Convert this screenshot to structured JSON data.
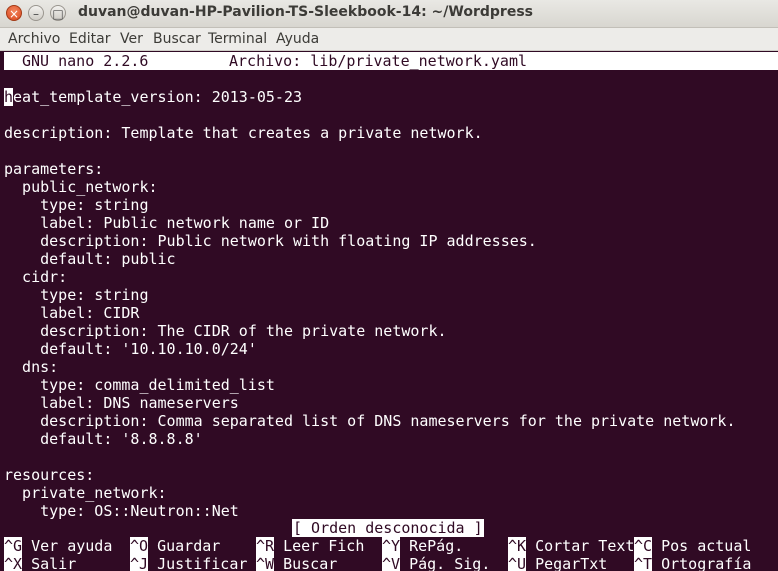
{
  "window": {
    "title": "duvan@duvan-HP-Pavilion-TS-Sleekbook-14: ~/Wordpress",
    "buttons": {
      "close": "×",
      "minimize": "–",
      "maximize": "□"
    }
  },
  "menubar": {
    "items": [
      "Archivo",
      "Editar",
      "Ver",
      "Buscar",
      "Terminal",
      "Ayuda"
    ]
  },
  "nano": {
    "version": "GNU nano 2.2.6",
    "file_label": "Archivo: lib/private_network.yaml",
    "cursor_char": "h",
    "lines": [
      "eat_template_version: 2013-05-23",
      "",
      "description: Template that creates a private network.",
      "",
      "parameters:",
      "  public_network:",
      "    type: string",
      "    label: Public network name or ID",
      "    description: Public network with floating IP addresses.",
      "    default: public",
      "  cidr:",
      "    type: string",
      "    label: CIDR",
      "    description: The CIDR of the private network.",
      "    default: '10.10.10.0/24'",
      "  dns:",
      "    type: comma_delimited_list",
      "    label: DNS nameservers",
      "    description: Comma separated list of DNS nameservers for the private network.",
      "    default: '8.8.8.8'",
      "",
      "resources:",
      "  private_network:",
      "    type: OS::Neutron::Net"
    ],
    "status_message": "[ Orden desconocida ]",
    "shortcuts_row1": [
      {
        "key": "^G",
        "label": "Ver ayuda"
      },
      {
        "key": "^O",
        "label": "Guardar"
      },
      {
        "key": "^R",
        "label": "Leer Fich"
      },
      {
        "key": "^Y",
        "label": "RePág."
      },
      {
        "key": "^K",
        "label": "Cortar Text"
      },
      {
        "key": "^C",
        "label": "Pos actual"
      }
    ],
    "shortcuts_row2": [
      {
        "key": "^X",
        "label": "Salir"
      },
      {
        "key": "^J",
        "label": "Justificar"
      },
      {
        "key": "^W",
        "label": "Buscar"
      },
      {
        "key": "^V",
        "label": "Pág. Sig."
      },
      {
        "key": "^U",
        "label": "PegarTxt"
      },
      {
        "key": "^T",
        "label": "Ortografía"
      }
    ]
  }
}
